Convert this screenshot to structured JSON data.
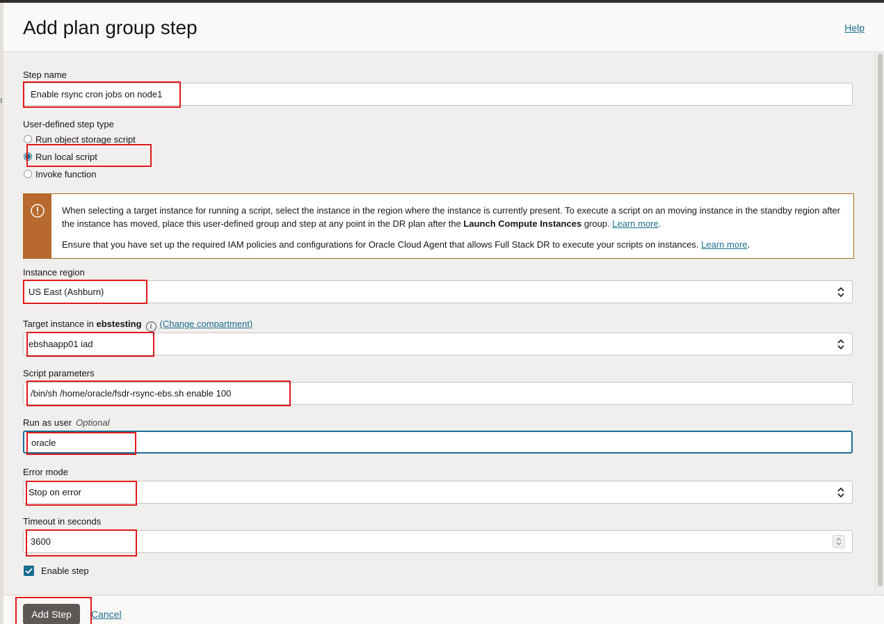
{
  "dialog": {
    "title": "Add plan group step",
    "help_label": "Help"
  },
  "form": {
    "step_name": {
      "label": "Step name",
      "value": "Enable rsync cron jobs on node1"
    },
    "step_type": {
      "label": "User-defined step type",
      "options": [
        "Run object storage script",
        "Run local script",
        "Invoke function"
      ],
      "selected": "Run local script"
    },
    "notice": {
      "paragraph1": "When selecting a target instance for running a script, select the instance in the region where the instance is currently present. To execute a script on an moving instance in the standby region after the instance has moved, place this user-defined group and step at any point in the DR plan after the ",
      "paragraph1_bold": "Launch Compute Instances",
      "paragraph1_end": " group. ",
      "paragraph1_link": "Learn more",
      "paragraph2": "Ensure that you have set up the required IAM policies and configurations for Oracle Cloud Agent that allows Full Stack DR to execute your scripts on instances. ",
      "paragraph2_link": "Learn more",
      "period": "."
    },
    "instance_region": {
      "label": "Instance region",
      "value": "US East (Ashburn)"
    },
    "target_instance": {
      "label_prefix": "Target instance in ",
      "compartment": "ebstesting",
      "change_link": "(Change compartment)",
      "value": "ebshaapp01 iad"
    },
    "script_parameters": {
      "label": "Script parameters",
      "value": "/bin/sh /home/oracle/fsdr-rsync-ebs.sh enable 100"
    },
    "run_as_user": {
      "label": "Run as user",
      "optional": "Optional",
      "value": "oracle"
    },
    "error_mode": {
      "label": "Error mode",
      "value": "Stop on error"
    },
    "timeout": {
      "label": "Timeout in seconds",
      "value": "3600"
    },
    "enable_step": {
      "label": "Enable step",
      "checked": true
    }
  },
  "footer": {
    "add_label": "Add Step",
    "cancel_label": "Cancel"
  },
  "colors": {
    "accent": "#1b6d8f",
    "warning": "#b8692d",
    "highlight": "#e0191c"
  }
}
